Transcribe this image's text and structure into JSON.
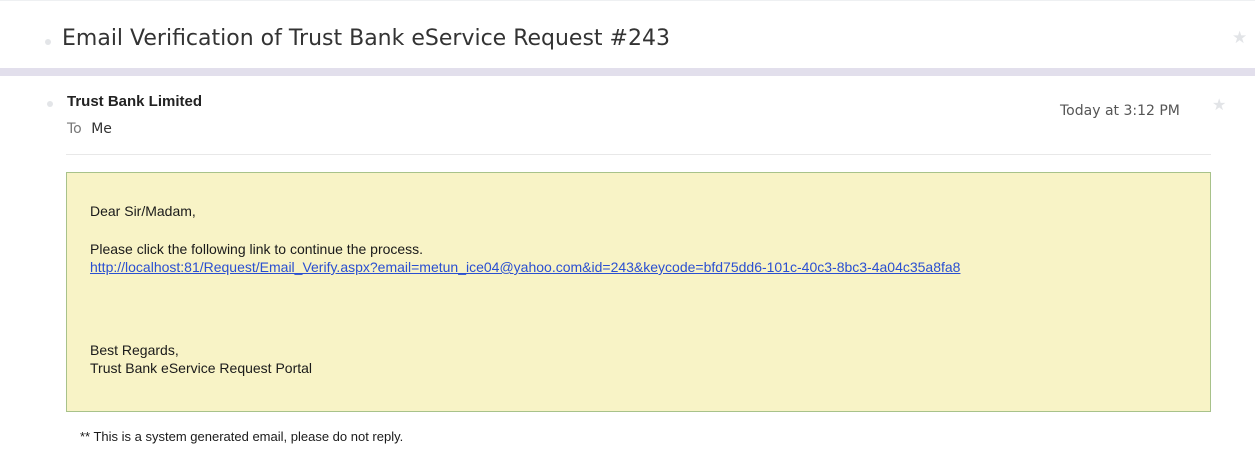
{
  "email": {
    "subject": "Email Verification of Trust Bank eService Request #243",
    "sender": "Trust Bank Limited",
    "to_label": "To",
    "to_value": "Me",
    "timestamp": "Today at 3:12 PM"
  },
  "message": {
    "greeting": "Dear Sir/Madam,",
    "instruction": "Please click the following link to continue the process.",
    "link": "http://localhost:81/Request/Email_Verify.aspx?email=metun_ice04@yahoo.com&id=243&keycode=bfd75dd6-101c-40c3-8bc3-4a04c35a8fa8",
    "regards": "Best Regards,",
    "signature": "Trust Bank eService Request Portal"
  },
  "footer": {
    "note": "** This is a system generated email, please do not reply."
  },
  "icons": {
    "star": "star-icon",
    "unread_dot": "dot-icon"
  },
  "colors": {
    "message_background": "#f8f3c6",
    "message_border": "#a8c28a",
    "link": "#2a4fd1",
    "divider": "#e2dfec"
  }
}
